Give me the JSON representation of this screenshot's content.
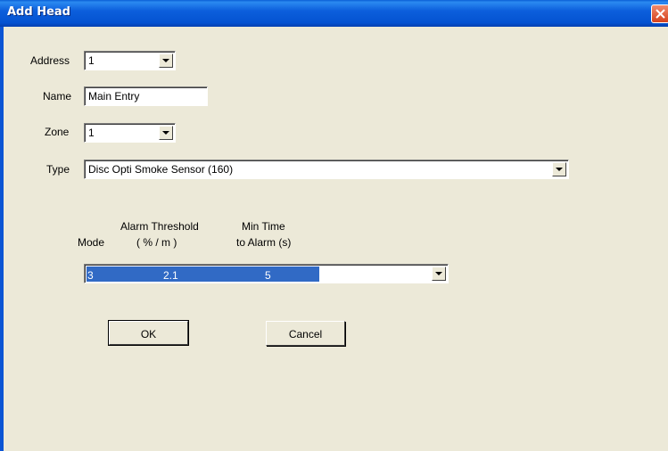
{
  "window": {
    "title": "Add Head"
  },
  "form": {
    "address": {
      "label": "Address",
      "value": "1"
    },
    "name": {
      "label": "Name",
      "value": "Main Entry"
    },
    "zone": {
      "label": "Zone",
      "value": "1"
    },
    "type": {
      "label": "Type",
      "value": "Disc Opti Smoke Sensor (160)"
    }
  },
  "mode_table": {
    "headers": {
      "mode": "Mode",
      "alarm_threshold_line1": "Alarm Threshold",
      "alarm_threshold_line2": "( % / m )",
      "min_time_line1": "Min Time",
      "min_time_line2": "to Alarm (s)"
    },
    "selected_row": {
      "mode": "3",
      "alarm_threshold": "2.1",
      "min_time": "5"
    }
  },
  "buttons": {
    "ok": "OK",
    "cancel": "Cancel"
  },
  "colors": {
    "titlebar": "#0c5fdc",
    "selection": "#316ac5",
    "dialog_bg": "#ece9d8",
    "close_button": "#d6421d"
  },
  "icons": {
    "close": "close-x-icon",
    "dropdown": "chevron-down-icon"
  }
}
